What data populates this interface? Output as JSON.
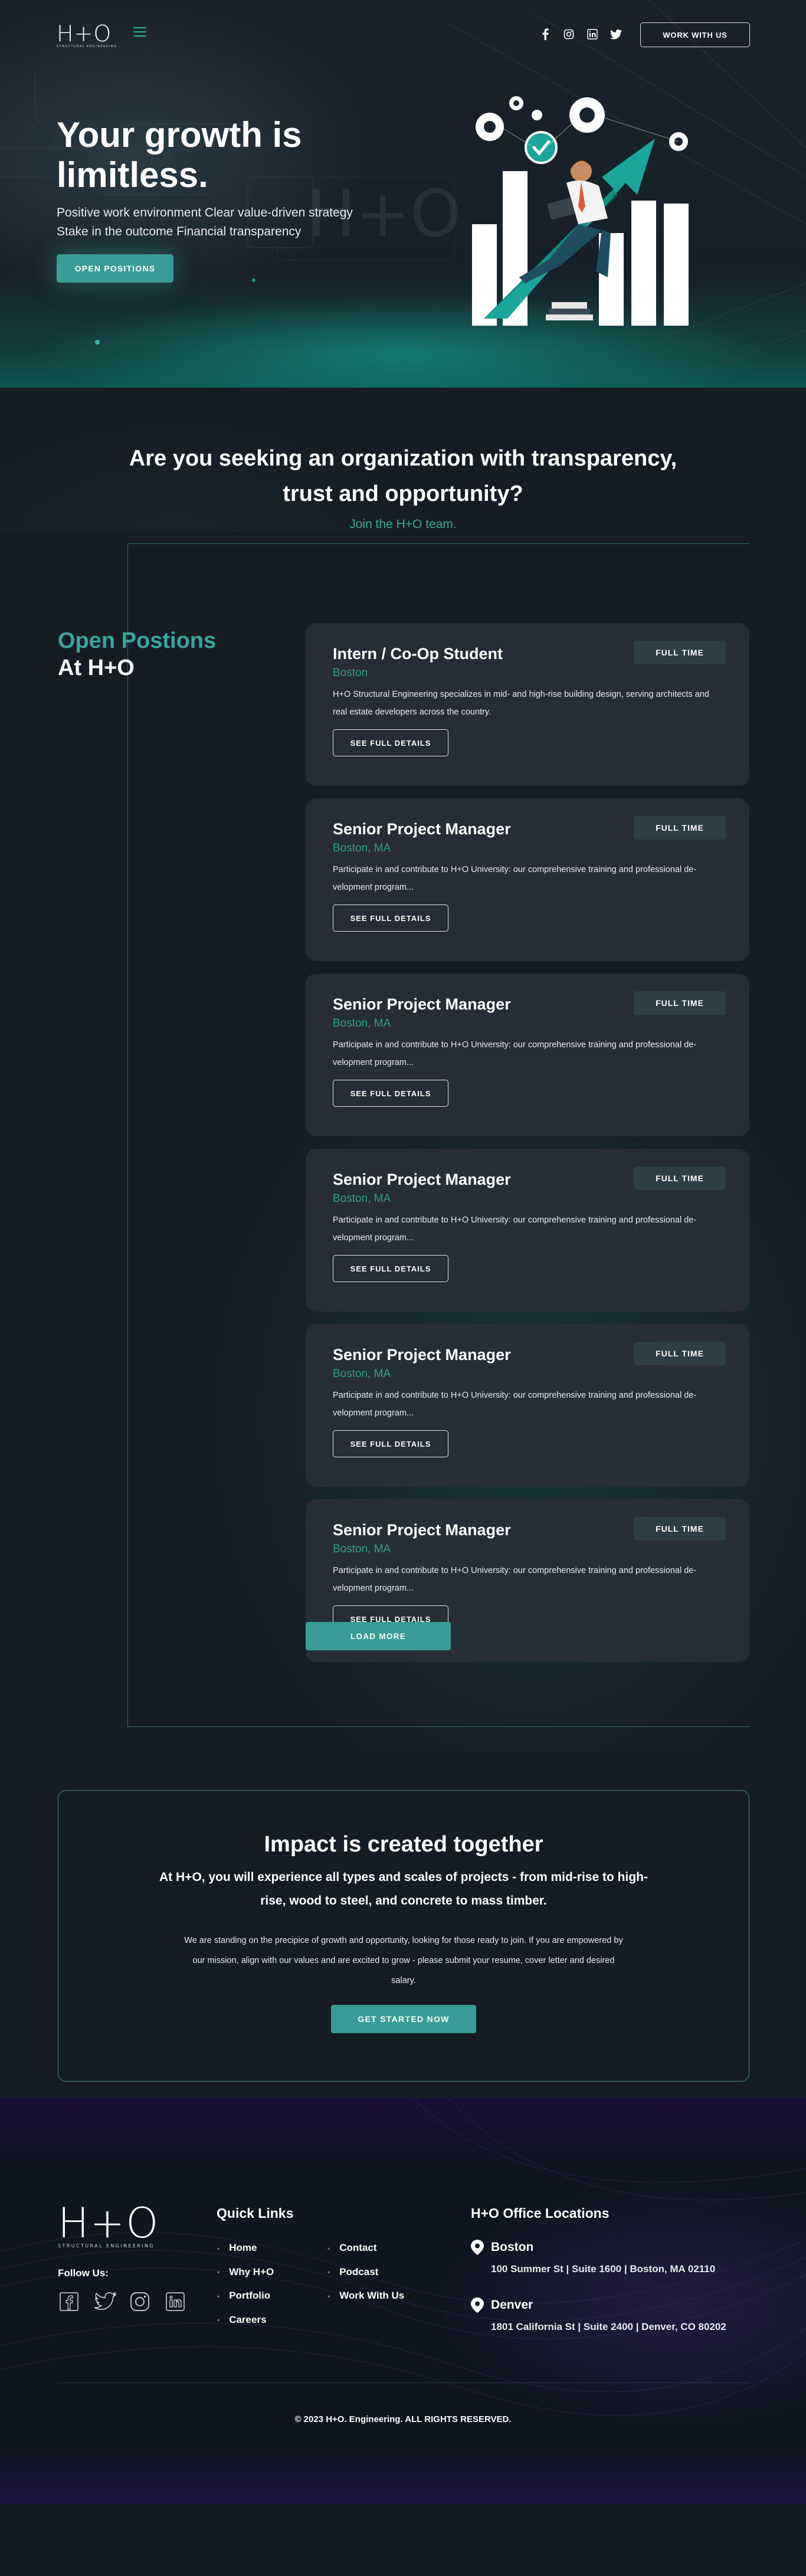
{
  "brand": {
    "logo": "H+O",
    "logo_sub": "STRUCTURAL ENGINEERING"
  },
  "header": {
    "menu_icon": "hamburger-icon",
    "socials": [
      "facebook-icon",
      "instagram-icon",
      "linkedin-icon",
      "twitter-icon"
    ],
    "work_with_us": "WORK WITH US"
  },
  "hero": {
    "title_line1": "Your growth is",
    "title_line2": "limitless.",
    "line1": "Positive work environment Clear value-driven strategy",
    "line2": "Stake in the outcome Financial transparency",
    "cta": "OPEN POSITIONS"
  },
  "seeking": {
    "title": "Are you seeking an organization with transparency, trust and opportunity?",
    "subtitle": "Join the H+O team."
  },
  "positions": {
    "heading_line1": "Open Postions",
    "heading_line2": "At H+O",
    "details_label": "SEE FULL DETAILS",
    "load_more": "LOAD MORE",
    "jobs": [
      {
        "title": "Intern / Co-Op Student",
        "location": "Boston",
        "badge": "FULL TIME",
        "description": "H+O Structural Engineering specializes in mid- and high-rise building design, serving architects and real estate developers across the country."
      },
      {
        "title": "Senior Project Manager",
        "location": "Boston, MA",
        "badge": "FULL TIME",
        "description": "Participate in and contribute to H+O University: our comprehensive training and professional de-velopment program..."
      },
      {
        "title": "Senior Project Manager",
        "location": "Boston, MA",
        "badge": "FULL TIME",
        "description": "Participate in and contribute to H+O University: our comprehensive training and professional de-velopment program..."
      },
      {
        "title": "Senior Project Manager",
        "location": "Boston, MA",
        "badge": "FULL TIME",
        "description": "Participate in and contribute to H+O University: our comprehensive training and professional de-velopment program..."
      },
      {
        "title": "Senior Project Manager",
        "location": "Boston, MA",
        "badge": "FULL TIME",
        "description": "Participate in and contribute to H+O University: our comprehensive training and professional de-velopment program..."
      },
      {
        "title": "Senior Project Manager",
        "location": "Boston, MA",
        "badge": "FULL TIME",
        "description": "Participate in and contribute to H+O University: our comprehensive training and professional de-velopment program..."
      }
    ]
  },
  "impact": {
    "title": "Impact is created together",
    "lead": "At H+O, you will experience all types and scales of projects - from mid-rise to high-rise, wood to steel, and concrete to mass timber.",
    "body": "We are standing on the precipice of growth and opportunity, looking for those ready to join. If you are empowered by our mission, align with our values and are excited to grow - please submit your resume, cover letter and desired salary.",
    "cta": "GET STARTED NOW"
  },
  "footer": {
    "follow_us": "Follow Us:",
    "socials": [
      "facebook-icon",
      "twitter-icon",
      "instagram-icon",
      "linkedin-icon"
    ],
    "quick_links_title": "Quick Links",
    "quick_links_col1": [
      "Home",
      "Why H+O",
      "Portfolio",
      "Careers"
    ],
    "quick_links_col2": [
      "Contact",
      "Podcast",
      "Work With Us"
    ],
    "offices_title": "H+O Office Locations",
    "offices": [
      {
        "city": "Boston",
        "address": "100 Summer St | Suite 1600 | Boston, MA 02110"
      },
      {
        "city": "Denver",
        "address": "1801 California St | Suite 2400 | Denver, CO 80202"
      }
    ],
    "copyright": "© 2023 H+O. Engineering. ALL RIGHTS RESERVED."
  },
  "colors": {
    "accent": "#3a9c96",
    "accent_text": "#3aa69b",
    "background": "#161c25",
    "card": "#282f39"
  }
}
